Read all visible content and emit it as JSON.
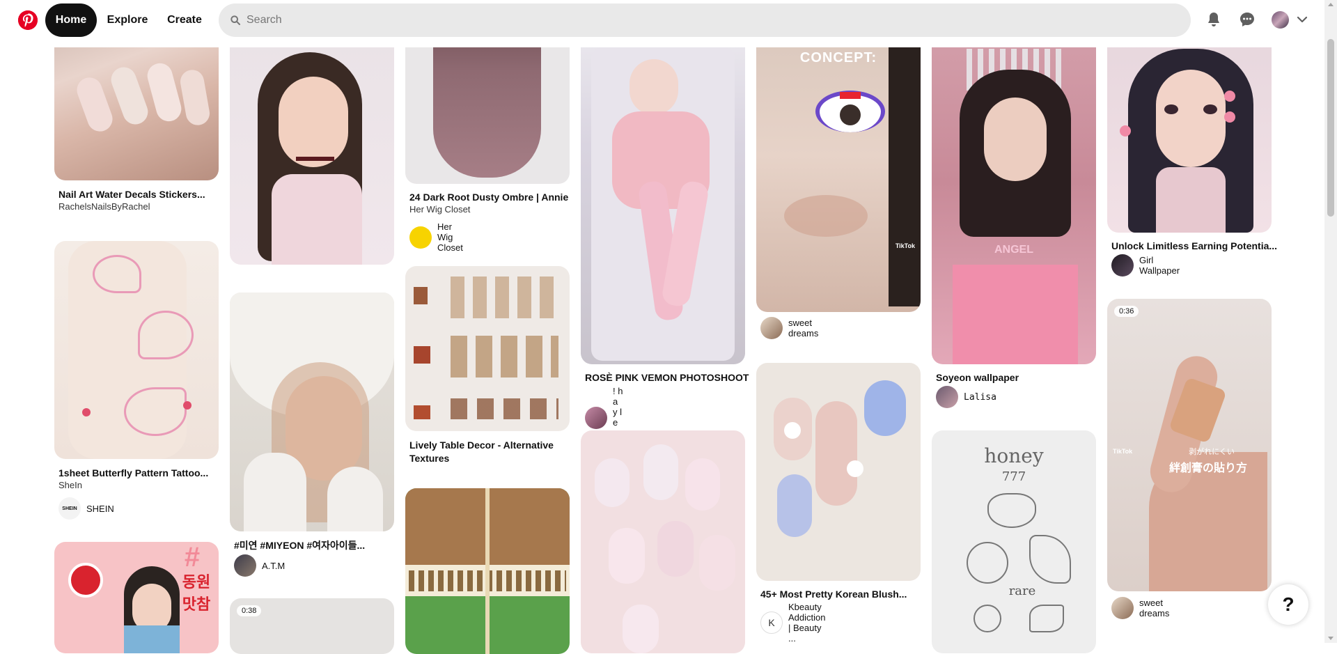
{
  "header": {
    "nav": {
      "home": "Home",
      "explore": "Explore",
      "create": "Create"
    },
    "search": {
      "placeholder": "Search",
      "value": ""
    },
    "icons": {
      "logo": "pinterest-logo",
      "bell": "bell-icon",
      "messages": "chat-bubble-icon",
      "account_menu": "chevron-down-icon"
    }
  },
  "pins": [
    {
      "title": "Nail Art Water Decals Stickers...",
      "subtitle": "RachelsNailsByRachel"
    },
    {
      "title": "1sheet Butterfly Pattern Tattoo...",
      "subtitle": "SheIn",
      "creator": "SHEIN",
      "creator_avatar_text": "SHEIN"
    },
    {
      "overlay": [
        "#",
        "동원",
        "맛참"
      ]
    },
    {
      "title": ""
    },
    {
      "title": "#미연 #MIYEON #여자아이들...",
      "creator": "A.T.M"
    },
    {
      "badge": "0:38"
    },
    {
      "title": "24 Dark Root Dusty Ombre | Annie",
      "subtitle": "Her Wig Closet",
      "creator": "Her Wig Closet"
    },
    {
      "title": "Lively Table Decor - Alternative",
      "title2": "Textures"
    },
    {
      "title": ""
    },
    {
      "title": "ROSÈ PINK VEMON PHOTOSHOOT",
      "creator": "! h a y l e e 🎀"
    },
    {
      "title": ""
    },
    {
      "overlay": [
        "CONCEPT:"
      ],
      "watermark": "TikTok",
      "creator": "sweet dreams"
    },
    {
      "title": "45+ Most Pretty Korean Blush...",
      "creator": "Kbeauty Addiction | Beauty ...",
      "creator_avatar_text": "K"
    },
    {
      "overlay": [
        "ANGEL"
      ],
      "title": "Soyeon wallpaper",
      "creator": "Lalisa"
    },
    {
      "overlay": [
        "honey",
        "777",
        "rare"
      ]
    },
    {
      "title": "Unlock Limitless Earning Potentia...",
      "creator": "Girl Wallpaper"
    },
    {
      "badge": "0:36",
      "overlay": [
        "剥がれにくい",
        "絆創膏の貼り方"
      ],
      "watermark": "TikTok",
      "creator": "sweet dreams"
    }
  ],
  "help": {
    "label": "?"
  }
}
